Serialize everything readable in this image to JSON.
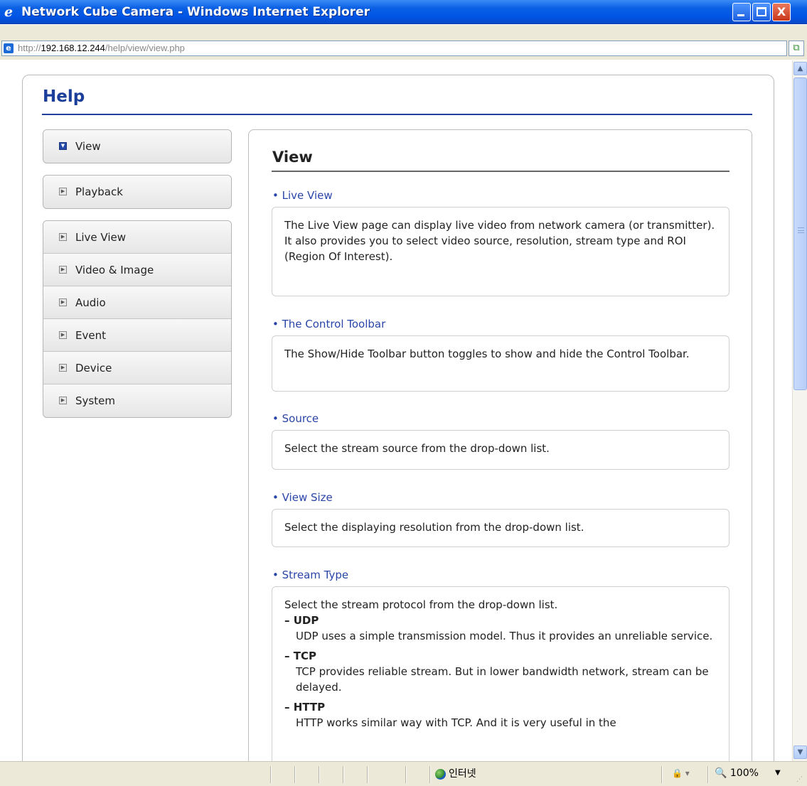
{
  "window": {
    "title": "Network Cube Camera - Windows Internet Explorer",
    "minimize_label": "",
    "close_label": "X"
  },
  "address": {
    "scheme": "http://",
    "host": "192.168.12.244",
    "path": "/help/view/view.php"
  },
  "help": {
    "title": "Help"
  },
  "nav": {
    "top": [
      {
        "label": "View",
        "active": true
      },
      {
        "label": "Playback",
        "active": false
      }
    ],
    "sections": [
      {
        "label": "Live View"
      },
      {
        "label": "Video & Image"
      },
      {
        "label": "Audio"
      },
      {
        "label": "Event"
      },
      {
        "label": "Device"
      },
      {
        "label": "System"
      }
    ]
  },
  "content": {
    "title": "View",
    "sections": [
      {
        "label": "• Live View",
        "lines": [
          "The Live View page can display live video from network camera (or transmitter).",
          "It also provides you to select video source, resolution, stream type and ROI (Region Of Interest)."
        ]
      },
      {
        "label": "• The Control Toolbar",
        "lines": [
          "The Show/Hide Toolbar button toggles to show and hide the Control Toolbar."
        ]
      },
      {
        "label": "• Source",
        "lines": [
          "Select the stream source from the drop-down list."
        ]
      },
      {
        "label": "• View Size",
        "lines": [
          "Select the displaying resolution from the drop-down list."
        ]
      },
      {
        "label": "• Stream Type",
        "intro": "Select the stream protocol from the drop-down list.",
        "items": [
          {
            "head": "– UDP",
            "body": "UDP uses a simple transmission model. Thus it provides an unreliable service."
          },
          {
            "head": "– TCP",
            "body": "TCP provides reliable stream. But in lower bandwidth network, stream can be delayed."
          },
          {
            "head": "– HTTP",
            "body": "HTTP works similar way with TCP. And it is very useful in the"
          }
        ]
      }
    ]
  },
  "status": {
    "zone": "인터넷",
    "lock": "🔒 ▾",
    "zoom": "🔍 100%",
    "zoom_caret": "▼"
  }
}
